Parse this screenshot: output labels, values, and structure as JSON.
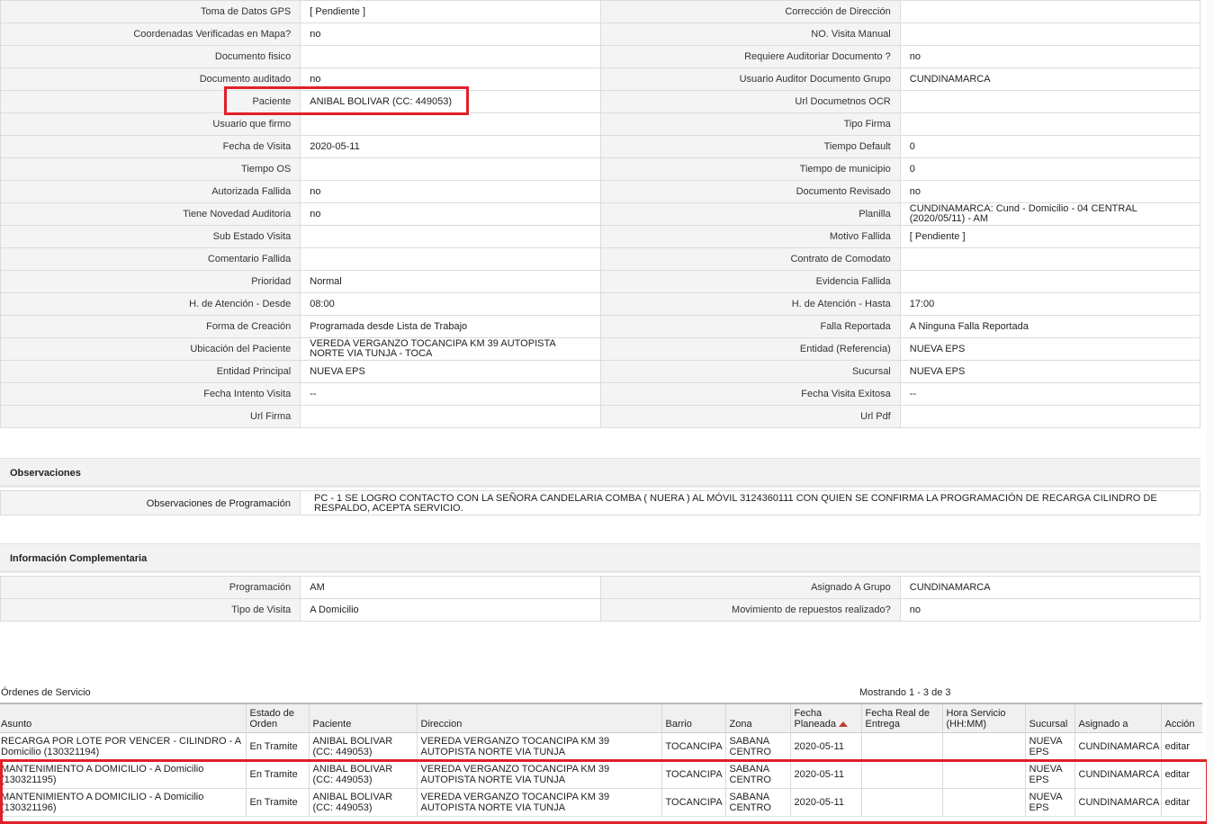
{
  "detail_rows": [
    {
      "l1": "Toma de Datos GPS",
      "v1": "[ Pendiente ]",
      "l2": "Corrección de Dirección",
      "v2": ""
    },
    {
      "l1": "Coordenadas Verificadas en Mapa?",
      "v1": "no",
      "l2": "NO. Visita Manual",
      "v2": ""
    },
    {
      "l1": "Documento fisico",
      "v1": "",
      "l2": "Requiere Auditoriar Documento ?",
      "v2": "no"
    },
    {
      "l1": "Documento auditado",
      "v1": "no",
      "l2": "Usuario Auditor Documento Grupo",
      "v2": "CUNDINAMARCA"
    },
    {
      "l1": "Paciente",
      "v1": "ANIBAL BOLIVAR (CC: 449053)",
      "l2": "Url Documetnos OCR",
      "v2": ""
    },
    {
      "l1": "Usuario que firmo",
      "v1": "",
      "l2": "Tipo Firma",
      "v2": ""
    },
    {
      "l1": "Fecha de Visita",
      "v1": "2020-05-11",
      "l2": "Tiempo Default",
      "v2": "0"
    },
    {
      "l1": "Tiempo OS",
      "v1": "",
      "l2": "Tiempo de municipio",
      "v2": "0"
    },
    {
      "l1": "Autorizada Fallida",
      "v1": "no",
      "l2": "Documento Revisado",
      "v2": "no"
    },
    {
      "l1": "Tiene Novedad Auditoria",
      "v1": "no",
      "l2": "Planilla",
      "v2": "CUNDINAMARCA: Cund - Domicilio - 04 CENTRAL (2020/05/11) - AM"
    },
    {
      "l1": "Sub Estado Visita",
      "v1": "",
      "l2": "Motivo Fallida",
      "v2": "[ Pendiente ]"
    },
    {
      "l1": "Comentario Fallida",
      "v1": "",
      "l2": "Contrato de Comodato",
      "v2": ""
    },
    {
      "l1": "Prioridad",
      "v1": "Normal",
      "l2": "Evidencia Fallida",
      "v2": ""
    },
    {
      "l1": "H. de Atención - Desde",
      "v1": "08:00",
      "l2": "H. de Atención - Hasta",
      "v2": "17:00"
    },
    {
      "l1": "Forma de Creación",
      "v1": "Programada desde Lista de Trabajo",
      "l2": "Falla Reportada",
      "v2": "A Ninguna Falla Reportada"
    },
    {
      "l1": "Ubicación del Paciente",
      "v1": "VEREDA VERGANZO TOCANCIPA KM 39 AUTOPISTA NORTE VIA TUNJA - TOCA",
      "l2": "Entidad (Referencia)",
      "v2": "NUEVA EPS"
    },
    {
      "l1": "Entidad Principal",
      "v1": "NUEVA EPS",
      "l2": "Sucursal",
      "v2": "NUEVA EPS"
    },
    {
      "l1": "Fecha Intento Visita",
      "v1": "--",
      "l2": "Fecha Visita Exitosa",
      "v2": "--"
    },
    {
      "l1": "Url Firma",
      "v1": "",
      "l2": "Url Pdf",
      "v2": ""
    }
  ],
  "observaciones": {
    "title": "Observaciones",
    "label": "Observaciones de Programación",
    "value": "PC - 1 SE LOGRO CONTACTO CON LA SEÑORA CANDELARIA COMBA ( NUERA ) AL MÓVIL 3124360111 CON QUIEN SE CONFIRMA LA PROGRAMACIÓN DE RECARGA CILINDRO DE RESPALDO, ACEPTA SERVICIO."
  },
  "complementaria": {
    "title": "Información Complementaria",
    "rows": [
      {
        "l1": "Programación",
        "v1": "AM",
        "l2": "Asignado A Grupo",
        "v2": "CUNDINAMARCA"
      },
      {
        "l1": "Tipo de Visita",
        "v1": "A Domicilio",
        "l2": "Movimiento de repuestos realizado?",
        "v2": "no"
      }
    ]
  },
  "orders": {
    "title": "Órdenes de Servicio",
    "showing": "Mostrando 1 - 3 de 3",
    "headers": [
      "Asunto",
      "Estado de Orden",
      "Paciente",
      "Direccion",
      "Barrio",
      "Zona",
      "Fecha Planeada",
      "Fecha Real de Entrega",
      "Hora Servicio (HH:MM)",
      "Sucursal",
      "Asignado a",
      "Acción"
    ],
    "rows": [
      {
        "asunto": "RECARGA POR LOTE POR VENCER - CILINDRO - A Domicilio (130321194)",
        "estado": "En Tramite",
        "paciente": "ANIBAL BOLIVAR (CC: 449053)",
        "direccion": "VEREDA VERGANZO TOCANCIPA KM 39 AUTOPISTA NORTE VIA TUNJA",
        "barrio": "TOCANCIPA",
        "zona": "SABANA CENTRO",
        "fecha": "2020-05-11",
        "real": "",
        "hora": "",
        "sucursal": "NUEVA EPS",
        "asignado": "CUNDINAMARCA",
        "accion": "editar"
      },
      {
        "asunto": "MANTENIMIENTO A DOMICILIO - A Domicilio (130321195)",
        "estado": "En Tramite",
        "paciente": "ANIBAL BOLIVAR (CC: 449053)",
        "direccion": "VEREDA VERGANZO TOCANCIPA KM 39 AUTOPISTA NORTE VIA TUNJA",
        "barrio": "TOCANCIPA",
        "zona": "SABANA CENTRO",
        "fecha": "2020-05-11",
        "real": "",
        "hora": "",
        "sucursal": "NUEVA EPS",
        "asignado": "CUNDINAMARCA",
        "accion": "editar"
      },
      {
        "asunto": "MANTENIMIENTO A DOMICILIO - A Domicilio (130321196)",
        "estado": "En Tramite",
        "paciente": "ANIBAL BOLIVAR (CC: 449053)",
        "direccion": "VEREDA VERGANZO TOCANCIPA KM 39 AUTOPISTA NORTE VIA TUNJA",
        "barrio": "TOCANCIPA",
        "zona": "SABANA CENTRO",
        "fecha": "2020-05-11",
        "real": "",
        "hora": "",
        "sucursal": "NUEVA EPS",
        "asignado": "CUNDINAMARCA",
        "accion": "editar"
      }
    ]
  },
  "colors": {
    "highlight": "#e0202a",
    "sort_arrow": "#c0392b"
  }
}
